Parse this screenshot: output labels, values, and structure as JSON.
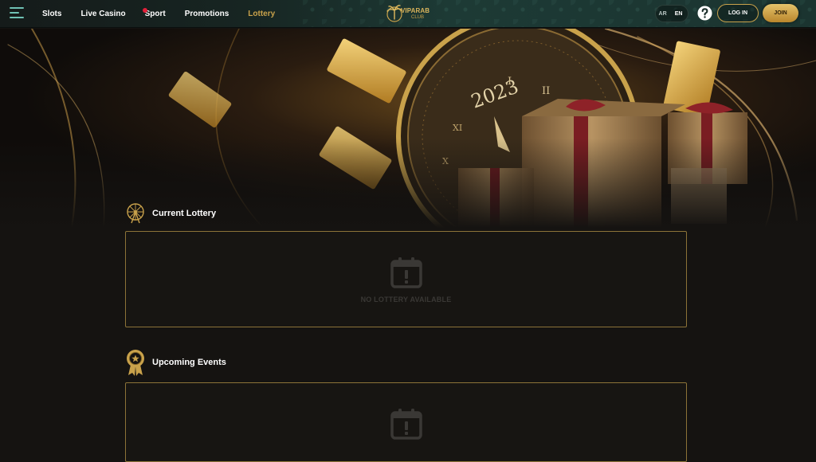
{
  "header": {
    "nav": [
      {
        "label": "Slots"
      },
      {
        "label": "Live Casino"
      },
      {
        "label": "Sport"
      },
      {
        "label": "Promotions"
      },
      {
        "label": "Lottery"
      }
    ],
    "logo": {
      "text": "VIPARAB",
      "sub": "CLUB"
    },
    "languages": [
      "AR",
      "EN"
    ],
    "selected_language": "EN",
    "login_label": "LOG IN",
    "join_label": "JOIN",
    "accent_color": "#c9a24b"
  },
  "hero": {
    "clock_year": "2023",
    "clock_numerals": [
      "I",
      "II",
      "XI",
      "X"
    ]
  },
  "current_lottery": {
    "title": "Current Lottery",
    "icon": "ferris-wheel-icon",
    "empty_icon": "calendar-alert-icon",
    "empty_text": "NO LOTTERY AVAILABLE"
  },
  "upcoming_events": {
    "title": "Upcoming Events",
    "icon": "award-badge-icon",
    "empty_icon": "calendar-alert-icon"
  }
}
